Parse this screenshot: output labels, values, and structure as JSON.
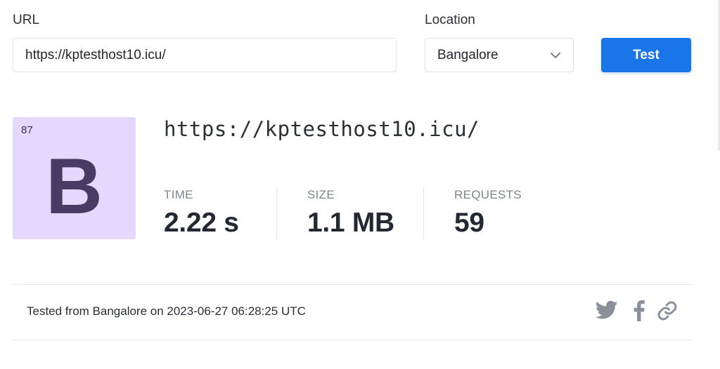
{
  "form": {
    "url_label": "URL",
    "url_value": "https://kptesthost10.icu/",
    "location_label": "Location",
    "location_value": "Bangalore",
    "test_button_label": "Test"
  },
  "result": {
    "grade_score": "87",
    "grade_letter": "B",
    "url": "https://kptesthost10.icu/",
    "metrics": [
      {
        "label": "TIME",
        "value": "2.22 s"
      },
      {
        "label": "SIZE",
        "value": "1.1 MB"
      },
      {
        "label": "REQUESTS",
        "value": "59"
      }
    ],
    "tested_info": "Tested from Bangalore on 2023-06-27 06:28:25 UTC"
  },
  "share": {
    "icons": [
      "twitter-icon",
      "facebook-icon",
      "link-icon"
    ]
  },
  "colors": {
    "accent": "#1a76e8",
    "grade_bg": "#e5d8fd",
    "grade_text": "#4a3a66",
    "muted": "#7c8591",
    "icon_gray": "#8a9099"
  }
}
